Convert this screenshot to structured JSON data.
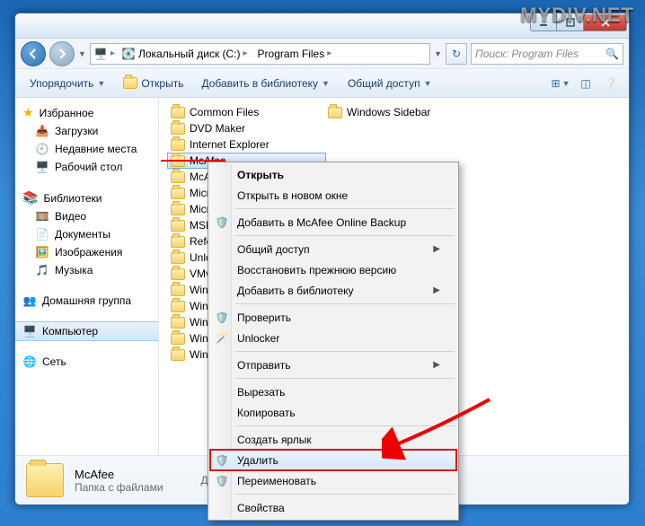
{
  "watermark": "MYDIV.NET",
  "address": {
    "disk_label": "Локальный диск (C:)",
    "folder": "Program Files"
  },
  "search": {
    "placeholder": "Поиск: Program Files"
  },
  "toolbar": {
    "organize": "Упорядочить",
    "open": "Открыть",
    "add_library": "Добавить в библиотеку",
    "share": "Общий доступ"
  },
  "nav": {
    "favorites": {
      "label": "Избранное",
      "items": [
        "Загрузки",
        "Недавние места",
        "Рабочий стол"
      ]
    },
    "libraries": {
      "label": "Библиотеки",
      "items": [
        "Видео",
        "Документы",
        "Изображения",
        "Музыка"
      ]
    },
    "homegroup": "Домашняя группа",
    "computer": "Компьютер",
    "network": "Сеть"
  },
  "folders_col1": [
    "Common Files",
    "DVD Maker",
    "Internet Explorer",
    "McAfee",
    "McA",
    "Micr",
    "Micr",
    "MSB",
    "Refe",
    "Unlo",
    "VMv",
    "Winc",
    "Winc",
    "Winc",
    "Winc",
    "Winc"
  ],
  "folders_col2": [
    "Windows Sidebar"
  ],
  "selected_folder_index": 3,
  "context_menu": {
    "open": "Открыть",
    "open_new": "Открыть в новом окне",
    "mcafee_backup": "Добавить в McAfee Online Backup",
    "share": "Общий доступ",
    "restore": "Восстановить прежнюю версию",
    "add_lib": "Добавить в библиотеку",
    "check": "Проверить",
    "unlocker": "Unlocker",
    "send_to": "Отправить",
    "cut": "Вырезать",
    "copy": "Копировать",
    "shortcut": "Создать ярлык",
    "delete": "Удалить",
    "rename": "Переименовать",
    "properties": "Свойства"
  },
  "details": {
    "name": "McAfee",
    "date_label": "Дата из",
    "type": "Папка с файлами"
  }
}
